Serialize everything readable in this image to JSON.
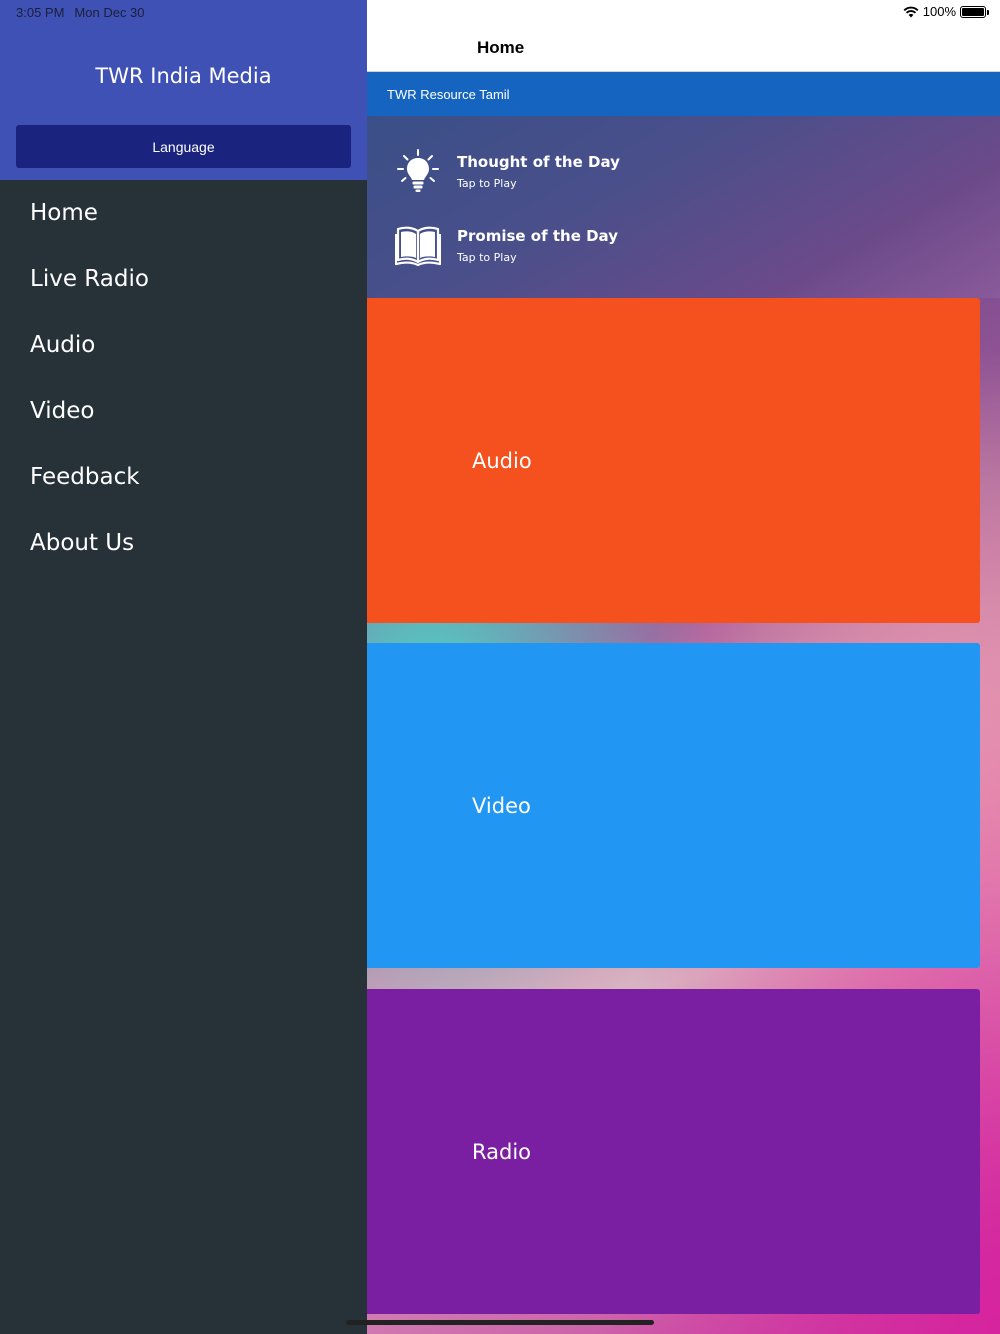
{
  "status": {
    "time": "3:05 PM",
    "date": "Mon Dec 30",
    "battery": "100%"
  },
  "sidebar": {
    "app_title": "TWR India Media",
    "language_button": "Language",
    "items": [
      {
        "label": "Home"
      },
      {
        "label": "Live Radio"
      },
      {
        "label": "Audio"
      },
      {
        "label": "Video"
      },
      {
        "label": "Feedback"
      },
      {
        "label": "About Us"
      }
    ]
  },
  "main": {
    "nav_title": "Home",
    "resource_title": "TWR Resource Tamil",
    "featured": [
      {
        "title": "Thought of the Day",
        "subtitle": "Tap to Play",
        "icon": "lightbulb-icon"
      },
      {
        "title": "Promise of the Day",
        "subtitle": "Tap to Play",
        "icon": "open-book-icon"
      }
    ],
    "tiles": [
      {
        "label": "Audio",
        "color": "#f4511e"
      },
      {
        "label": "Video",
        "color": "#2196f3"
      },
      {
        "label": "Radio",
        "color": "#7b1fa2"
      }
    ]
  },
  "colors": {
    "sidebar_header": "#3f51b5",
    "sidebar_bg": "#263238",
    "language_button": "#1a237e",
    "resource_bar": "#1565c0"
  }
}
